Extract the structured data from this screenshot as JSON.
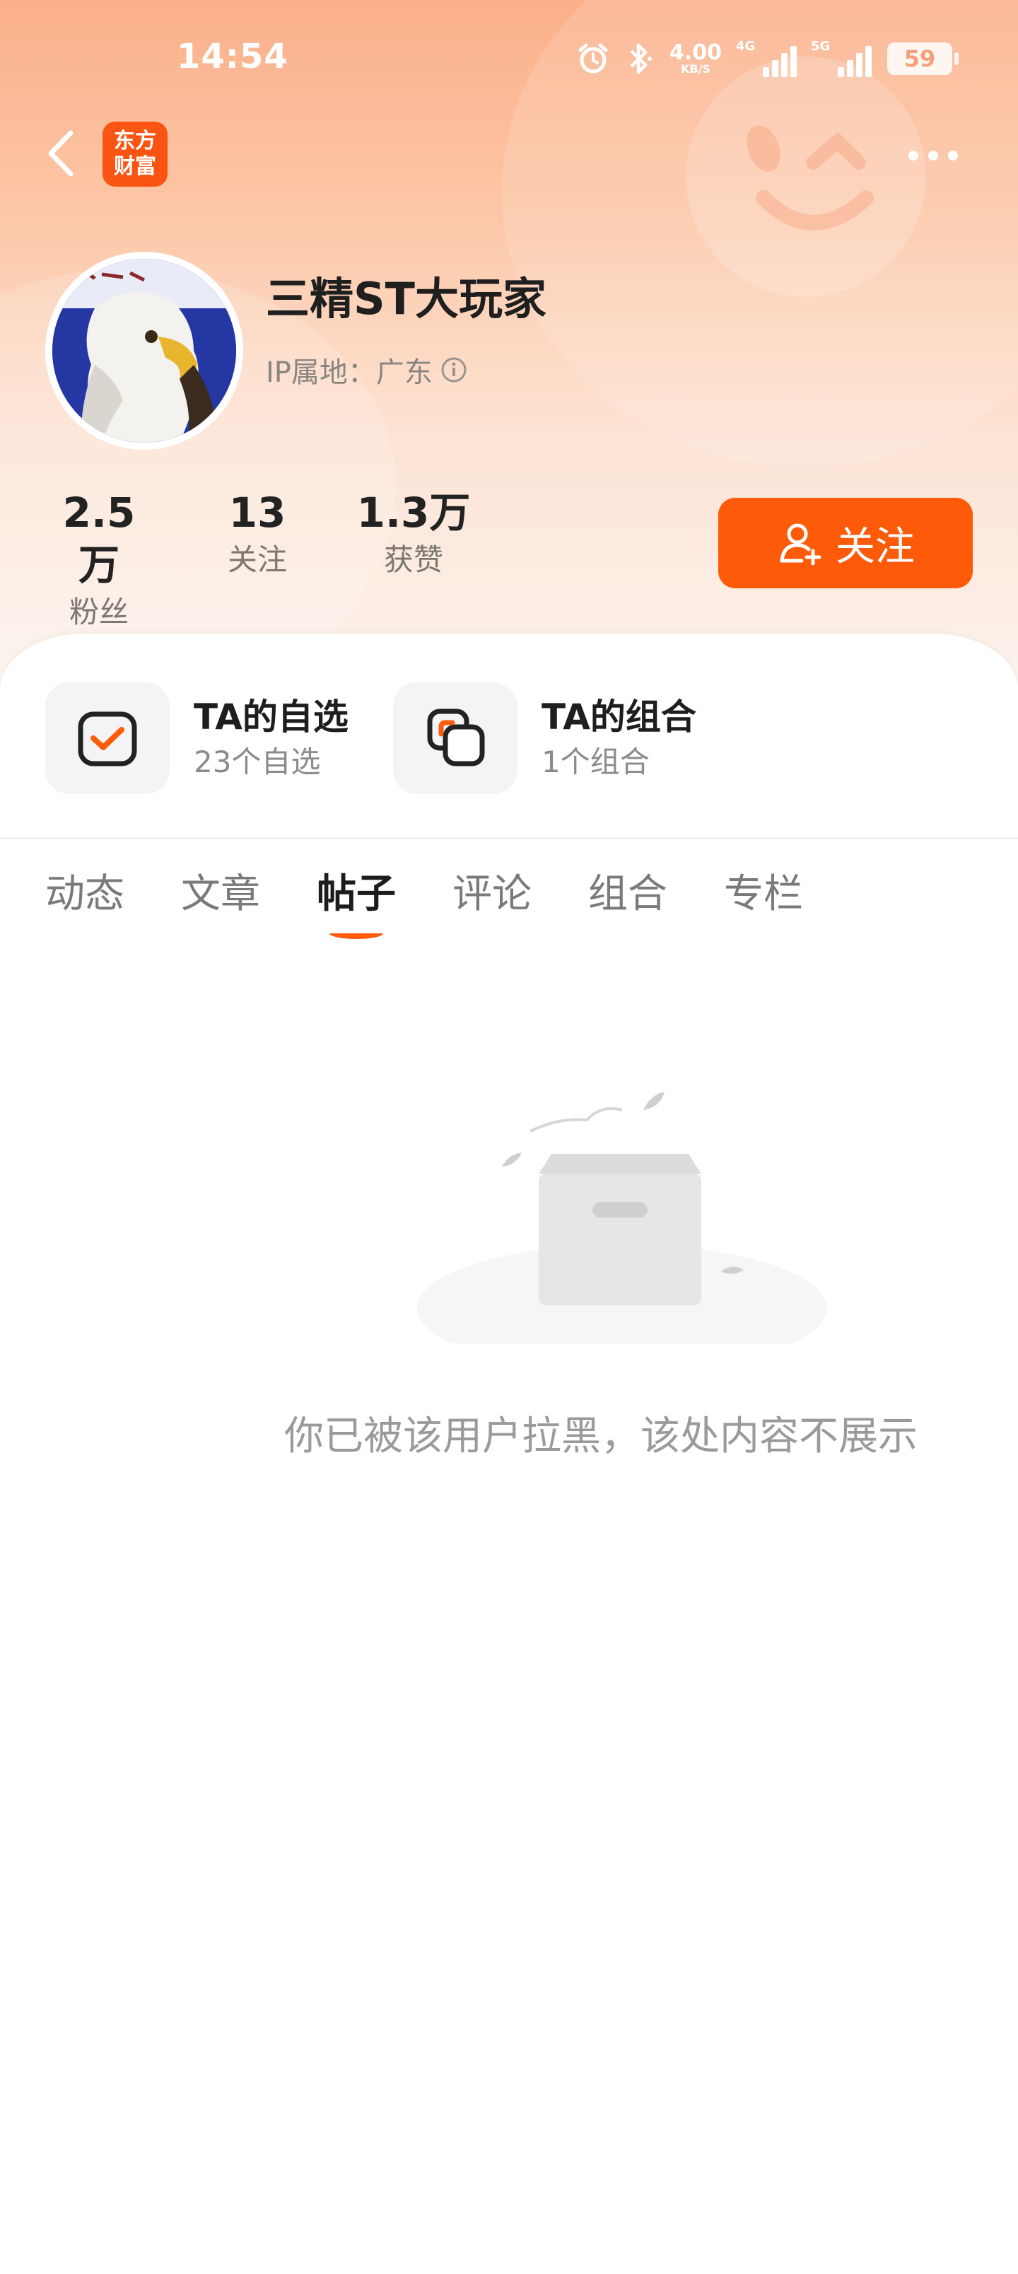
{
  "status_bar": {
    "time": "14:54",
    "net_speed": "4.00",
    "net_speed_unit": "KB/S",
    "signal1_label": "4G",
    "signal2_label": "5G",
    "battery": "59",
    "icons": [
      "alarm-icon",
      "bluetooth-icon",
      "signal-4g-icon",
      "signal-5g-icon",
      "battery-icon"
    ]
  },
  "nav": {
    "back_icon": "chevron-left-icon",
    "logo_line1": "东方",
    "logo_line2": "财富",
    "more_icon": "more-dots-icon"
  },
  "profile": {
    "username": "三精ST大玩家",
    "ip_label": "IP属地：广东",
    "avatar_desc": "eagle-avatar"
  },
  "stats": {
    "fans_value": "2.5万",
    "fans_label": "粉丝",
    "following_value": "13",
    "following_label": "关注",
    "likes_value": "1.3万",
    "likes_label": "获赞"
  },
  "follow_button": {
    "label": "关注"
  },
  "entries": {
    "watchlist_title": "TA的自选",
    "watchlist_sub": "23个自选",
    "portfolio_title": "TA的组合",
    "portfolio_sub": "1个组合"
  },
  "tabs": [
    {
      "label": "动态"
    },
    {
      "label": "文章"
    },
    {
      "label": "帖子"
    },
    {
      "label": "评论"
    },
    {
      "label": "组合"
    },
    {
      "label": "专栏"
    }
  ],
  "active_tab": "帖子",
  "empty_state": {
    "message": "你已被该用户拉黑，该处内容不展示"
  },
  "colors": {
    "accent": "#fd5a0a",
    "logo_bg": "#fa5413",
    "header_gradient_top": "#fbb08a",
    "text_primary": "#1f1f1f",
    "text_secondary": "#8b8b8b"
  }
}
